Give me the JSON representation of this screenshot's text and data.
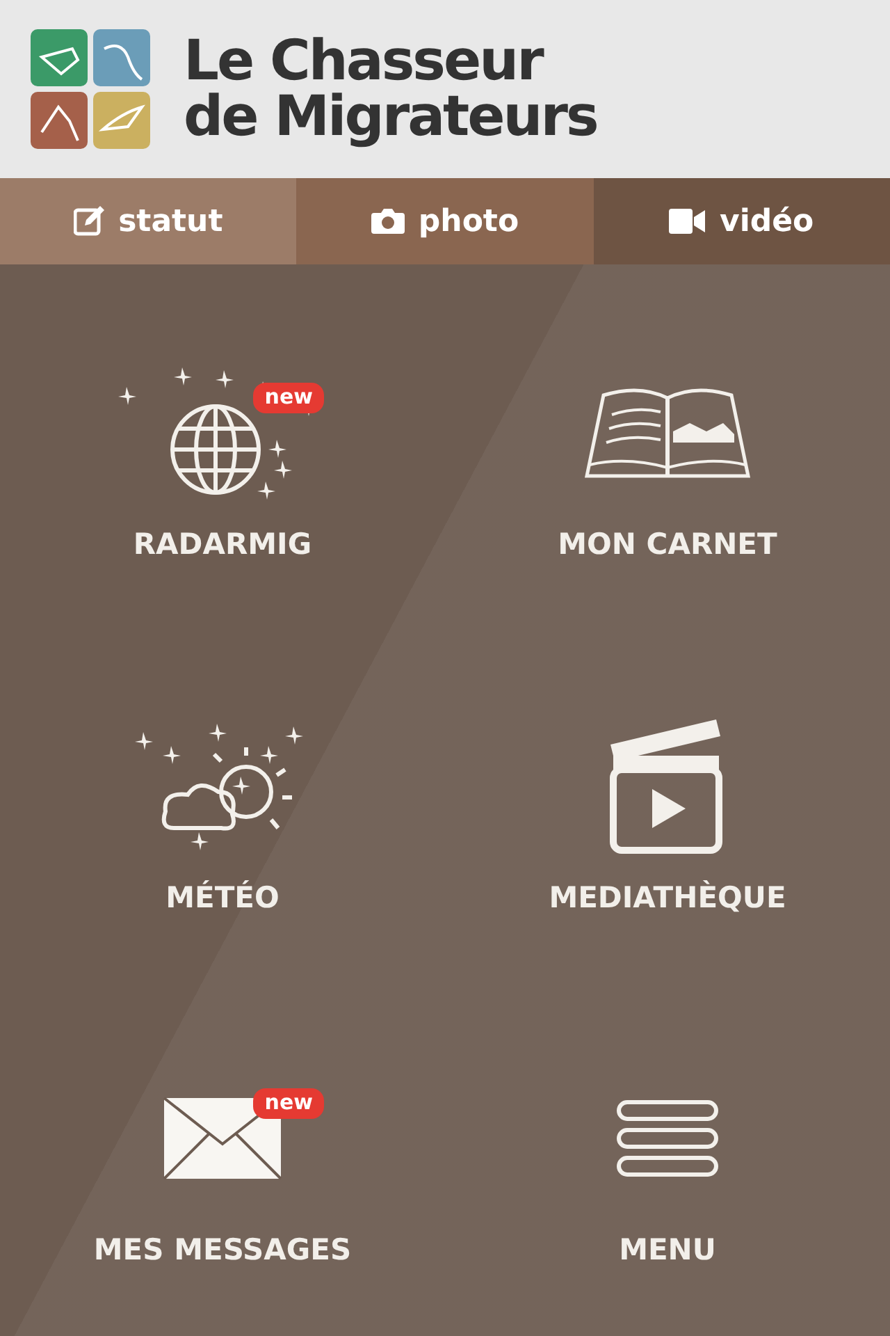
{
  "header": {
    "title_line_1": "Le Chasseur",
    "title_line_2": "de Migrateurs"
  },
  "tabs": [
    {
      "label": "statut",
      "kind": "edit",
      "color": "#9c7c68"
    },
    {
      "label": "photo",
      "kind": "camera",
      "color": "#8a6650"
    },
    {
      "label": "vidéo",
      "kind": "video",
      "color": "#6e5443"
    }
  ],
  "tiles": [
    {
      "label": "RADARMIG",
      "kind": "globe",
      "badge": "new"
    },
    {
      "label": "MON CARNET",
      "kind": "book"
    },
    {
      "label": "MÉTÉO",
      "kind": "weather"
    },
    {
      "label": "MEDIATHÈQUE",
      "kind": "clapper"
    },
    {
      "label": "MES MESSAGES",
      "kind": "envelope",
      "badge": "new"
    },
    {
      "label": "MENU",
      "kind": "menu"
    }
  ]
}
